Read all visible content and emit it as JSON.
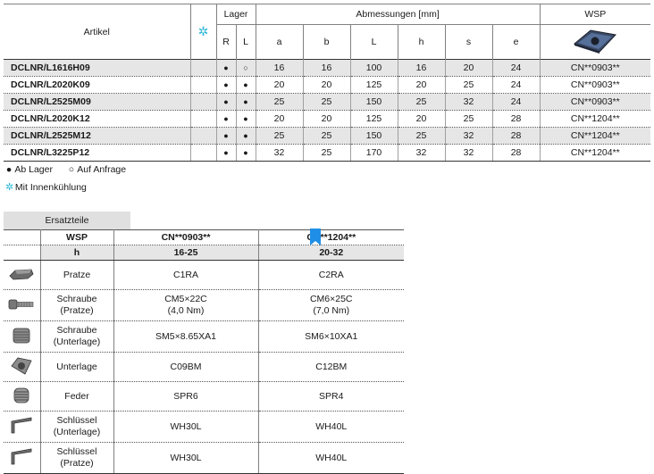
{
  "main_table": {
    "headers": {
      "artikel": "Artikel",
      "lager": "Lager",
      "lager_r": "R",
      "lager_l": "L",
      "abmessungen": "Abmessungen [mm]",
      "dims": [
        "a",
        "b",
        "L",
        "h",
        "s",
        "e"
      ],
      "wsp": "WSP"
    },
    "rows": [
      {
        "artikel": "DCLNR/L1616H09",
        "r": "●",
        "l": "○",
        "a": "16",
        "b": "16",
        "L": "100",
        "h": "16",
        "s": "20",
        "e": "24",
        "wsp": "CN**0903**"
      },
      {
        "artikel": "DCLNR/L2020K09",
        "r": "●",
        "l": "●",
        "a": "20",
        "b": "20",
        "L": "125",
        "h": "20",
        "s": "25",
        "e": "24",
        "wsp": "CN**0903**"
      },
      {
        "artikel": "DCLNR/L2525M09",
        "r": "●",
        "l": "●",
        "a": "25",
        "b": "25",
        "L": "150",
        "h": "25",
        "s": "32",
        "e": "24",
        "wsp": "CN**0903**"
      },
      {
        "artikel": "DCLNR/L2020K12",
        "r": "●",
        "l": "●",
        "a": "20",
        "b": "20",
        "L": "125",
        "h": "20",
        "s": "25",
        "e": "28",
        "wsp": "CN**1204**"
      },
      {
        "artikel": "DCLNR/L2525M12",
        "r": "●",
        "l": "●",
        "a": "25",
        "b": "25",
        "L": "150",
        "h": "25",
        "s": "32",
        "e": "28",
        "wsp": "CN**1204**"
      },
      {
        "artikel": "DCLNR/L3225P12",
        "r": "●",
        "l": "●",
        "a": "32",
        "b": "25",
        "L": "170",
        "h": "32",
        "s": "32",
        "e": "28",
        "wsp": "CN**1204**"
      }
    ]
  },
  "legend": {
    "ab_lager_sym": "●",
    "ab_lager": "Ab Lager",
    "auf_anfrage_sym": "○",
    "auf_anfrage": "Auf Anfrage",
    "innenkuehlung_sym": "✲",
    "innenkuehlung": "Mit Innenkühlung"
  },
  "ersatzteile": {
    "title": "Ersatzteile",
    "header": {
      "wsp_label": "WSP",
      "wsp_1": "CN**0903**",
      "wsp_2": "CN**1204**",
      "h_label": "h",
      "h_1": "16-25",
      "h_2": "20-32"
    },
    "rows": [
      {
        "icon": "clamp-icon",
        "label": "Pratze",
        "label2": "",
        "v1": "C1RA",
        "v1b": "",
        "v2": "C2RA",
        "v2b": ""
      },
      {
        "icon": "screw-icon",
        "label": "Schraube",
        "label2": "(Pratze)",
        "v1": "CM5×22C",
        "v1b": "(4,0 Nm)",
        "v2": "CM6×25C",
        "v2b": "(7,0 Nm)"
      },
      {
        "icon": "shim-screw-icon",
        "label": "Schraube",
        "label2": "(Unterlage)",
        "v1": "SM5×8.65XA1",
        "v1b": "",
        "v2": "SM6×10XA1",
        "v2b": ""
      },
      {
        "icon": "shim-icon",
        "label": "Unterlage",
        "label2": "",
        "v1": "C09BM",
        "v1b": "",
        "v2": "C12BM",
        "v2b": ""
      },
      {
        "icon": "spring-icon",
        "label": "Feder",
        "label2": "",
        "v1": "SPR6",
        "v1b": "",
        "v2": "SPR4",
        "v2b": ""
      },
      {
        "icon": "hex-key-icon",
        "label": "Schlüssel",
        "label2": "(Unterlage)",
        "v1": "WH30L",
        "v1b": "",
        "v2": "WH40L",
        "v2b": ""
      },
      {
        "icon": "hex-key-icon",
        "label": "Schlüssel",
        "label2": "(Pratze)",
        "v1": "WH30L",
        "v1b": "",
        "v2": "WH40L",
        "v2b": ""
      }
    ]
  },
  "colors": {
    "accent_cyan": "#2bb8d8",
    "row_shade": "#e6e6e6",
    "bookmark_blue": "#1f8ee6"
  }
}
